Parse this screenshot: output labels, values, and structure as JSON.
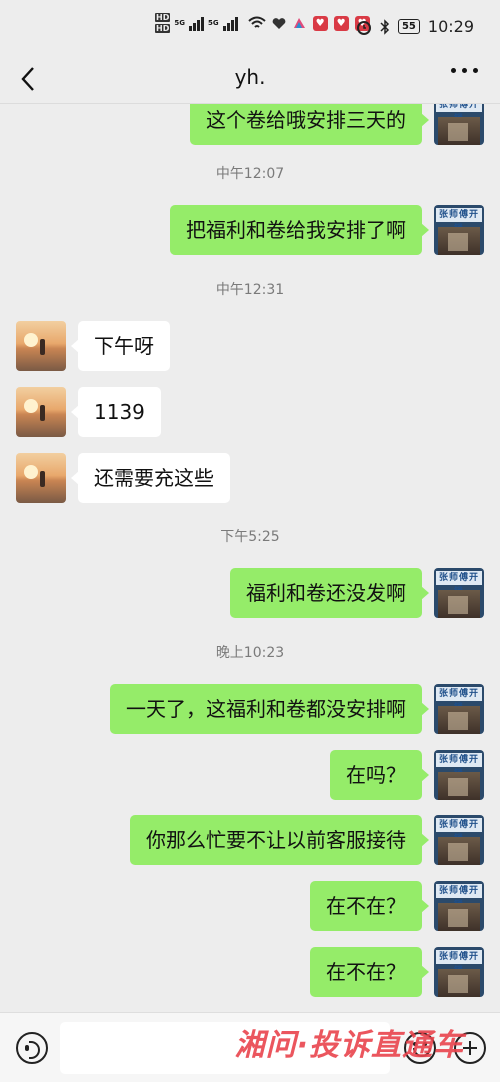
{
  "status_bar": {
    "hd_labels": [
      "HD",
      "HD"
    ],
    "network": [
      "5G",
      "5G"
    ],
    "battery": "55",
    "time": "10:29"
  },
  "nav": {
    "title": "yh."
  },
  "messages": [
    {
      "side": "me",
      "text": "这个卷给哦安排三天的"
    },
    {
      "side": "time",
      "text": "中午12:07"
    },
    {
      "side": "me",
      "text": "把福利和卷给我安排了啊"
    },
    {
      "side": "time",
      "text": "中午12:31"
    },
    {
      "side": "other",
      "text": "下午呀"
    },
    {
      "side": "other",
      "text": "1139"
    },
    {
      "side": "other",
      "text": "还需要充这些"
    },
    {
      "side": "time",
      "text": "下午5:25"
    },
    {
      "side": "me",
      "text": "福利和卷还没发啊"
    },
    {
      "side": "time",
      "text": "晚上10:23"
    },
    {
      "side": "me",
      "text": "一天了，这福利和卷都没安排啊"
    },
    {
      "side": "me",
      "text": "在吗？"
    },
    {
      "side": "me",
      "text": "你那么忙要不让以前客服接待"
    },
    {
      "side": "me",
      "text": "在不在？"
    },
    {
      "side": "me",
      "text": "在不在？"
    }
  ],
  "my_avatar_sign": "张师傅开锁",
  "input": {
    "value": "",
    "placeholder": ""
  },
  "watermark": "湘问·投诉直通车",
  "colors": {
    "background": "#ededed",
    "my_bubble": "#95ec69",
    "other_bubble": "#ffffff",
    "watermark": "#e9444d"
  },
  "icons": [
    "back-arrow-icon",
    "more-dots-icon",
    "voice-icon",
    "emoji-icon",
    "plus-icon"
  ]
}
